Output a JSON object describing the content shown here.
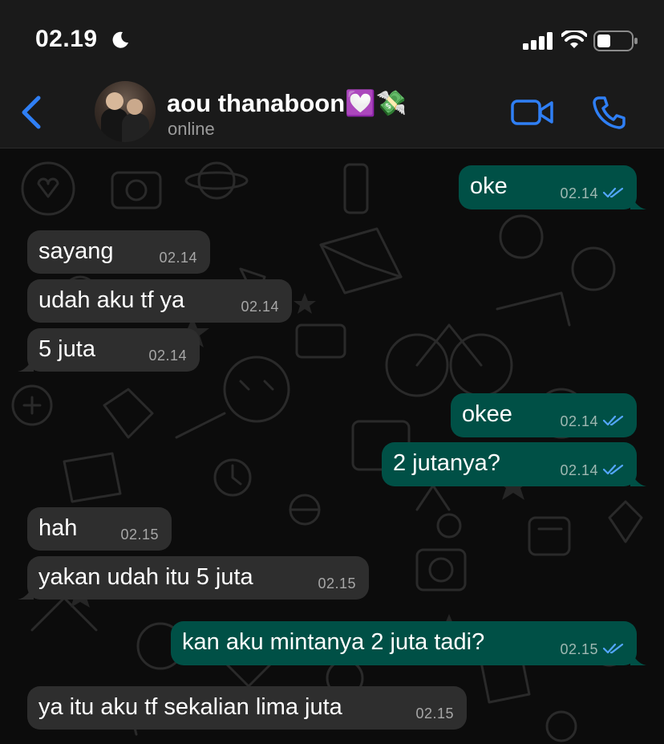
{
  "status_bar": {
    "time": "02.19",
    "moon_icon": "moon-icon",
    "signal_icon": "cellular-signal-icon",
    "wifi_icon": "wifi-icon",
    "battery_icon": "battery-icon"
  },
  "header": {
    "back_icon": "chevron-left-icon",
    "contact_name": "aou thanaboon💟💸",
    "contact_status": "online",
    "video_icon": "video-camera-icon",
    "phone_icon": "phone-icon",
    "accent": "#2f7ff5"
  },
  "messages": [
    {
      "dir": "out",
      "text": "oke",
      "time": "02.14",
      "read": true
    },
    {
      "dir": "in",
      "text": "sayang",
      "time": "02.14"
    },
    {
      "dir": "in",
      "text": "udah aku tf ya",
      "time": "02.14"
    },
    {
      "dir": "in",
      "text": "5 juta",
      "time": "02.14"
    },
    {
      "dir": "out",
      "text": "okee",
      "time": "02.14",
      "read": true
    },
    {
      "dir": "out",
      "text": "2 jutanya?",
      "time": "02.14",
      "read": true
    },
    {
      "dir": "in",
      "text": "hah",
      "time": "02.15"
    },
    {
      "dir": "in",
      "text": "yakan udah itu 5 juta",
      "time": "02.15"
    },
    {
      "dir": "out",
      "text": "kan aku mintanya 2 juta tadi?",
      "time": "02.15",
      "read": true
    },
    {
      "dir": "in",
      "text": "ya itu aku tf sekalian lima juta",
      "time": "02.15"
    }
  ],
  "colors": {
    "incoming_bubble": "#2e2e2e",
    "outgoing_bubble": "#005046",
    "read_ticks": "#53a6ff"
  }
}
